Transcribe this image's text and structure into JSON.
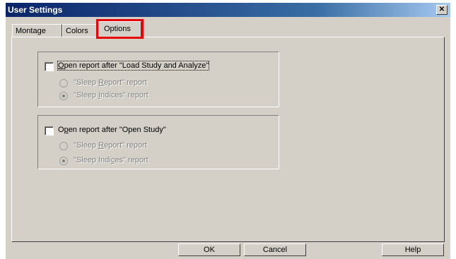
{
  "window": {
    "title": "User Settings",
    "close_glyph": "✕"
  },
  "tabs": [
    {
      "label": "Montage",
      "active": false
    },
    {
      "label": "Colors",
      "active": false
    },
    {
      "label": "Options",
      "active": true
    }
  ],
  "groups": [
    {
      "checkbox_label_pre": "",
      "checkbox_label_mnemonic": "O",
      "checkbox_label_post": "pen report after  \"Load Study and Analyze\"",
      "checked": false,
      "radio1_pre": "\"Sleep ",
      "radio1_mnemonic": "R",
      "radio1_post": "eport\" report",
      "radio2_pre": "\"Sleep ",
      "radio2_mnemonic": "I",
      "radio2_post": "ndices\" report",
      "selected_radio": 2
    },
    {
      "checkbox_label_pre": "O",
      "checkbox_label_mnemonic": "p",
      "checkbox_label_post": "en report after  \"Open Study\"",
      "checked": false,
      "radio1_pre": "\"Sleep ",
      "radio1_mnemonic": "R",
      "radio1_post": "eport\" report",
      "radio2_pre": "\"Sleep Indi",
      "radio2_mnemonic": "c",
      "radio2_post": "es\" report",
      "selected_radio": 2
    }
  ],
  "buttons": {
    "ok": "OK",
    "cancel": "Cancel",
    "help": "Help"
  },
  "highlight_color": "#e4060c"
}
